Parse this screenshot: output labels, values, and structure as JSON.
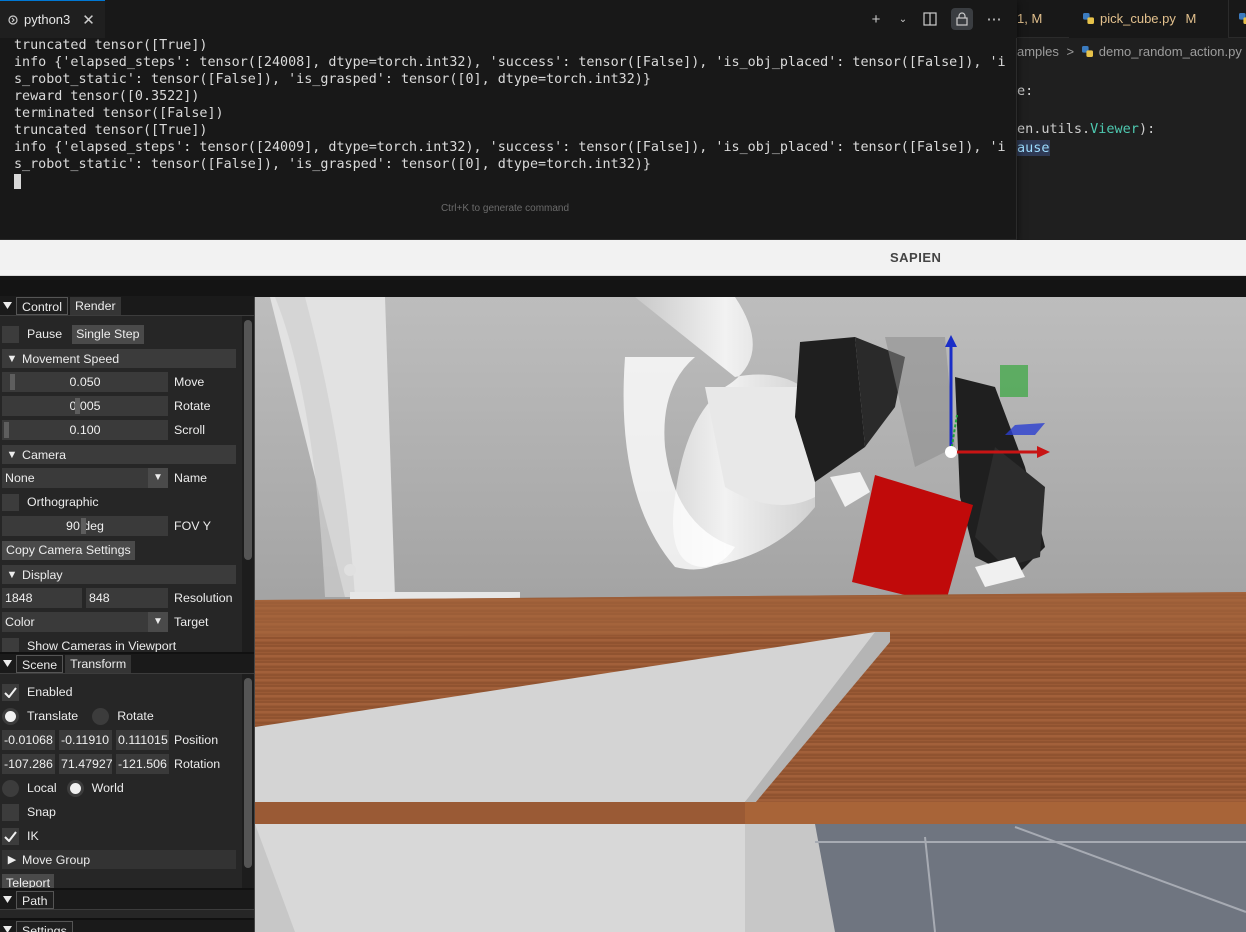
{
  "editor": {
    "tabs": [
      {
        "label": "1, M"
      },
      {
        "label": "pick_cube.py",
        "status": "M"
      },
      {
        "label": ""
      }
    ],
    "breadcrumb_a": "amples",
    "breadcrumb_sep": ">",
    "breadcrumb_b": "demo_random_action.py",
    "code_line_1": "e:",
    "code_line_2_a": "en.utils.",
    "code_line_2_b": "Viewer",
    "code_line_2_c": "):",
    "code_line_3": "ause"
  },
  "terminal": {
    "tab_label": "python3",
    "lines": [
      "truncated tensor([True])",
      "info {'elapsed_steps': tensor([24008], dtype=torch.int32), 'success': tensor([False]), 'is_obj_placed': tensor([False]), 'i",
      "s_robot_static': tensor([False]), 'is_grasped': tensor([0], dtype=torch.int32)}",
      "reward tensor([0.3522])",
      "terminated tensor([False])",
      "truncated tensor([True])",
      "info {'elapsed_steps': tensor([24009], dtype=torch.int32), 'success': tensor([False]), 'is_obj_placed': tensor([False]), 'i",
      "s_robot_static': tensor([False]), 'is_grasped': tensor([0], dtype=torch.int32)}"
    ],
    "hint": "Ctrl+K to generate command"
  },
  "sapien": {
    "title": "SAPIEN",
    "control_panel": {
      "tab_control": "Control",
      "tab_render": "Render",
      "pause_label": "Pause",
      "pause_checked": false,
      "single_step_label": "Single Step",
      "movement_speed_header": "Movement Speed",
      "move_value": "0.050",
      "move_label": "Move",
      "rotate_value": "0.005",
      "rotate_label": "Rotate",
      "scroll_value": "0.100",
      "scroll_label": "Scroll",
      "camera_header": "Camera",
      "camera_name_value": "None",
      "camera_name_label": "Name",
      "orthographic_label": "Orthographic",
      "fov_value": "90 deg",
      "fov_label": "FOV Y",
      "copy_camera_label": "Copy Camera Settings",
      "display_header": "Display",
      "res_width": "1848",
      "res_height": "848",
      "resolution_label": "Resolution",
      "target_value": "Color",
      "target_label": "Target",
      "show_cameras_label": "Show Cameras in Viewport"
    },
    "scene_panel": {
      "tab_scene": "Scene",
      "tab_transform": "Transform",
      "enabled_label": "Enabled",
      "enabled_checked": true,
      "translate_label": "Translate",
      "rotate_label": "Rotate",
      "position": [
        "-0.01068",
        "-0.11910",
        "0.111015"
      ],
      "position_label": "Position",
      "rotation": [
        "-107.286",
        "71.47927",
        "-121.506"
      ],
      "rotation_label": "Rotation",
      "local_label": "Local",
      "world_label": "World",
      "snap_label": "Snap",
      "snap_checked": false,
      "ik_label": "IK",
      "ik_checked": true,
      "move_group_header": "Move Group",
      "teleport_label": "Teleport"
    },
    "path_panel": {
      "tab_path": "Path"
    },
    "settings_panel": {
      "tab_settings": "Settings"
    }
  },
  "colors": {
    "cube": "#c00a0a",
    "table_wood": "#9a5a35",
    "axis_x": "#c81414",
    "axis_y": "#1fa53a",
    "axis_z": "#1a2ec8"
  }
}
